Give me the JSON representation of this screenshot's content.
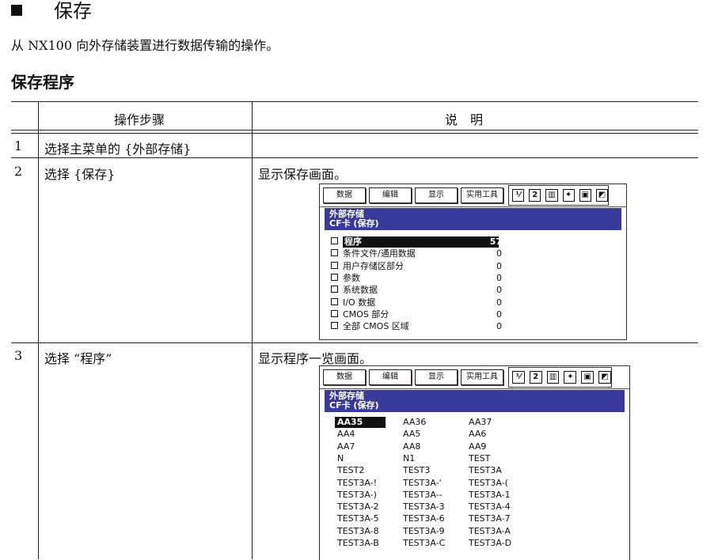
{
  "header": {
    "title": "保存",
    "intro": "从 NX100 向外存储装置进行数据传输的操作。",
    "subtitle": "保存程序"
  },
  "table": {
    "col_headers": [
      "操作步骤",
      "说　明"
    ],
    "rows": [
      {
        "num": "1",
        "step": "选择主菜单的 {外部存储}",
        "desc": ""
      },
      {
        "num": "2",
        "step": "选择 {保存}",
        "desc": "显示保存画面。"
      },
      {
        "num": "3",
        "step": "选择 “程序”",
        "desc": "显示程序一览画面。"
      }
    ]
  },
  "screen": {
    "menu": [
      "数据",
      "编辑",
      "显示",
      "实用工具"
    ],
    "title_lines": [
      "外部存储",
      "CF卡 (保存)"
    ],
    "save_items": [
      {
        "label": "程序",
        "count": "57",
        "selected": true
      },
      {
        "label": "条件文件/通用数据",
        "count": "0"
      },
      {
        "label": "用户存储区部分",
        "count": "0"
      },
      {
        "label": "参数",
        "count": "0"
      },
      {
        "label": "系统数据",
        "count": "0"
      },
      {
        "label": "I/O 数据",
        "count": "0"
      },
      {
        "label": "CMOS 部分",
        "count": "0"
      },
      {
        "label": "全部 CMOS 区域",
        "count": "0"
      }
    ],
    "programs": [
      "AA35",
      "AA36",
      "AA37",
      "AA4",
      "AA5",
      "AA6",
      "AA7",
      "AA8",
      "AA9",
      "N",
      "N1",
      "TEST",
      "TEST2",
      "TEST3",
      "TEST3A",
      "TEST3A-!",
      "TEST3A-'",
      "TEST3A-(",
      "TEST3A-)",
      "TEST3A--",
      "TEST3A-1",
      "TEST3A-2",
      "TEST3A-3",
      "TEST3A-4",
      "TEST3A-5",
      "TEST3A-6",
      "TEST3A-7",
      "TEST3A-8",
      "TEST3A-9",
      "TEST3A-A",
      "TEST3A-B",
      "TEST3A-C",
      "TEST3A-D"
    ],
    "selected_program": "AA35",
    "icons": [
      "robot-coord-icon",
      "number-icon",
      "servo-icon",
      "tool-icon",
      "display-icon",
      "page-icon"
    ]
  }
}
